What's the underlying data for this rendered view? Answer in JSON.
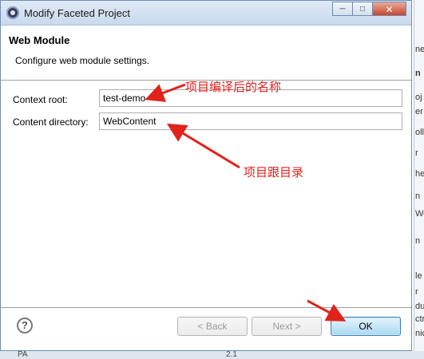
{
  "window": {
    "title": "Modify Faceted Project",
    "minimize_symbol": "─",
    "maximize_symbol": "□",
    "close_symbol": "✕"
  },
  "header": {
    "title": "Web Module",
    "description": "Configure web module settings."
  },
  "form": {
    "context_root": {
      "label": "Context root:",
      "value": "test-demo"
    },
    "content_directory": {
      "label": "Content directory:",
      "value": "WebContent"
    }
  },
  "annotations": {
    "context_root_note": "项目编译后的名称",
    "content_dir_note": "项目跟目录",
    "color": "#e0231c"
  },
  "buttons": {
    "help": "?",
    "back": "< Back",
    "next": "Next >",
    "ok": "OK"
  },
  "background": {
    "right_fragments": [
      "ne",
      "n",
      "oj",
      "er",
      "oll",
      "r",
      "he",
      "n",
      "We",
      "n",
      "le",
      "r",
      "du",
      "ctr",
      "nic"
    ],
    "bottom_left": "PA",
    "bottom_mid": "2.1"
  }
}
